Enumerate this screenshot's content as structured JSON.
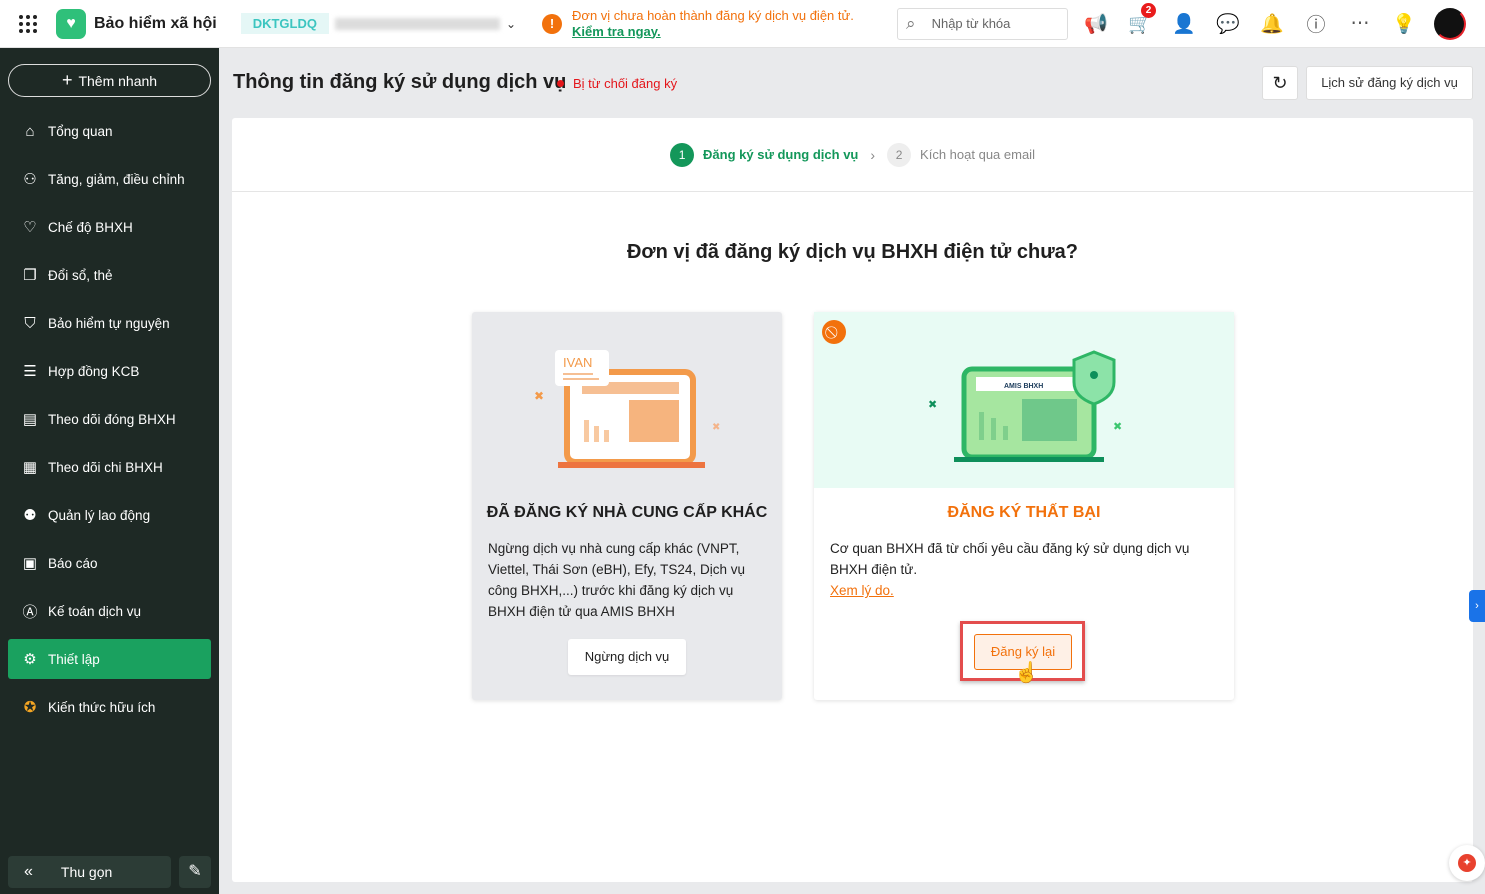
{
  "header": {
    "app_title": "Bảo hiểm xã hội",
    "tax_code": "DKTGLDQ",
    "warning_text": "Đơn vị chưa hoàn thành đăng ký dịch vụ điện tử. ",
    "warning_link": "Kiểm tra ngay.",
    "search_placeholder": "Nhập từ khóa",
    "cart_badge": "2"
  },
  "sidebar": {
    "quick_add": "Thêm nhanh",
    "items": [
      {
        "label": "Tổng quan",
        "icon": "home-icon"
      },
      {
        "label": "Tăng, giảm, điều chỉnh",
        "icon": "user-adjust-icon"
      },
      {
        "label": "Chế độ BHXH",
        "icon": "benefit-icon"
      },
      {
        "label": "Đổi sổ, thẻ",
        "icon": "card-icon"
      },
      {
        "label": "Bảo hiểm tự nguyện",
        "icon": "shield-icon"
      },
      {
        "label": "Hợp đồng KCB",
        "icon": "contract-icon"
      },
      {
        "label": "Theo dõi đóng BHXH",
        "icon": "c12-icon"
      },
      {
        "label": "Theo dõi chi BHXH",
        "icon": "payout-icon"
      },
      {
        "label": "Quản lý lao động",
        "icon": "users-icon"
      },
      {
        "label": "Báo cáo",
        "icon": "report-icon"
      },
      {
        "label": "Kế toán dịch vụ",
        "icon": "accounting-icon"
      },
      {
        "label": "Thiết lập",
        "icon": "gear-icon"
      },
      {
        "label": "Kiến thức hữu ích",
        "icon": "knowledge-icon"
      }
    ],
    "active_index": 11,
    "collapse": "Thu gọn"
  },
  "page": {
    "title": "Thông tin đăng ký sử dụng dịch vụ",
    "status": "Bị từ chối đăng ký",
    "history_button": "Lịch sử đăng ký dịch vụ"
  },
  "steps": [
    {
      "num": "1",
      "label": "Đăng ký sử dụng dịch vụ"
    },
    {
      "num": "2",
      "label": "Kích hoạt qua email"
    }
  ],
  "question": "Đơn vị đã đăng ký dịch vụ BHXH điện tử chưa?",
  "card1": {
    "badge": "IVAN",
    "title": "ĐÃ ĐĂNG KÝ NHÀ CUNG CẤP KHÁC",
    "desc": "Ngừng dịch vụ nhà cung cấp khác (VNPT, Viettel, Thái Sơn (eBH), Efy, TS24, Dịch vụ công BHXH,...) trước khi đăng ký dịch vụ BHXH điện tử qua AMIS BHXH",
    "button": "Ngừng dịch vụ"
  },
  "card2": {
    "badge": "AMIS BHXH",
    "title": "ĐĂNG KÝ THẤT BẠI",
    "desc": "Cơ quan BHXH đã từ chối yêu cầu đăng ký sử dụng dịch vụ BHXH điện tử.",
    "link": "Xem lý do.",
    "button": "Đăng ký lại"
  },
  "colors": {
    "brand": "#1aa15f",
    "warning": "#f2710c",
    "danger": "#e4161b"
  }
}
